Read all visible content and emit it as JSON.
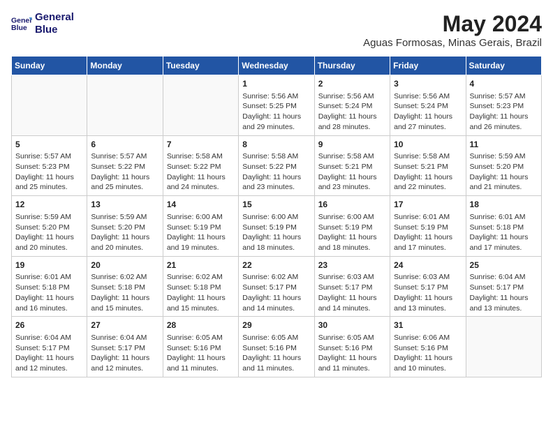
{
  "logo": {
    "line1": "General",
    "line2": "Blue"
  },
  "title": "May 2024",
  "location": "Aguas Formosas, Minas Gerais, Brazil",
  "weekdays": [
    "Sunday",
    "Monday",
    "Tuesday",
    "Wednesday",
    "Thursday",
    "Friday",
    "Saturday"
  ],
  "weeks": [
    [
      {
        "day": "",
        "info": ""
      },
      {
        "day": "",
        "info": ""
      },
      {
        "day": "",
        "info": ""
      },
      {
        "day": "1",
        "info": "Sunrise: 5:56 AM\nSunset: 5:25 PM\nDaylight: 11 hours\nand 29 minutes."
      },
      {
        "day": "2",
        "info": "Sunrise: 5:56 AM\nSunset: 5:24 PM\nDaylight: 11 hours\nand 28 minutes."
      },
      {
        "day": "3",
        "info": "Sunrise: 5:56 AM\nSunset: 5:24 PM\nDaylight: 11 hours\nand 27 minutes."
      },
      {
        "day": "4",
        "info": "Sunrise: 5:57 AM\nSunset: 5:23 PM\nDaylight: 11 hours\nand 26 minutes."
      }
    ],
    [
      {
        "day": "5",
        "info": "Sunrise: 5:57 AM\nSunset: 5:23 PM\nDaylight: 11 hours\nand 25 minutes."
      },
      {
        "day": "6",
        "info": "Sunrise: 5:57 AM\nSunset: 5:22 PM\nDaylight: 11 hours\nand 25 minutes."
      },
      {
        "day": "7",
        "info": "Sunrise: 5:58 AM\nSunset: 5:22 PM\nDaylight: 11 hours\nand 24 minutes."
      },
      {
        "day": "8",
        "info": "Sunrise: 5:58 AM\nSunset: 5:22 PM\nDaylight: 11 hours\nand 23 minutes."
      },
      {
        "day": "9",
        "info": "Sunrise: 5:58 AM\nSunset: 5:21 PM\nDaylight: 11 hours\nand 23 minutes."
      },
      {
        "day": "10",
        "info": "Sunrise: 5:58 AM\nSunset: 5:21 PM\nDaylight: 11 hours\nand 22 minutes."
      },
      {
        "day": "11",
        "info": "Sunrise: 5:59 AM\nSunset: 5:20 PM\nDaylight: 11 hours\nand 21 minutes."
      }
    ],
    [
      {
        "day": "12",
        "info": "Sunrise: 5:59 AM\nSunset: 5:20 PM\nDaylight: 11 hours\nand 20 minutes."
      },
      {
        "day": "13",
        "info": "Sunrise: 5:59 AM\nSunset: 5:20 PM\nDaylight: 11 hours\nand 20 minutes."
      },
      {
        "day": "14",
        "info": "Sunrise: 6:00 AM\nSunset: 5:19 PM\nDaylight: 11 hours\nand 19 minutes."
      },
      {
        "day": "15",
        "info": "Sunrise: 6:00 AM\nSunset: 5:19 PM\nDaylight: 11 hours\nand 18 minutes."
      },
      {
        "day": "16",
        "info": "Sunrise: 6:00 AM\nSunset: 5:19 PM\nDaylight: 11 hours\nand 18 minutes."
      },
      {
        "day": "17",
        "info": "Sunrise: 6:01 AM\nSunset: 5:19 PM\nDaylight: 11 hours\nand 17 minutes."
      },
      {
        "day": "18",
        "info": "Sunrise: 6:01 AM\nSunset: 5:18 PM\nDaylight: 11 hours\nand 17 minutes."
      }
    ],
    [
      {
        "day": "19",
        "info": "Sunrise: 6:01 AM\nSunset: 5:18 PM\nDaylight: 11 hours\nand 16 minutes."
      },
      {
        "day": "20",
        "info": "Sunrise: 6:02 AM\nSunset: 5:18 PM\nDaylight: 11 hours\nand 15 minutes."
      },
      {
        "day": "21",
        "info": "Sunrise: 6:02 AM\nSunset: 5:18 PM\nDaylight: 11 hours\nand 15 minutes."
      },
      {
        "day": "22",
        "info": "Sunrise: 6:02 AM\nSunset: 5:17 PM\nDaylight: 11 hours\nand 14 minutes."
      },
      {
        "day": "23",
        "info": "Sunrise: 6:03 AM\nSunset: 5:17 PM\nDaylight: 11 hours\nand 14 minutes."
      },
      {
        "day": "24",
        "info": "Sunrise: 6:03 AM\nSunset: 5:17 PM\nDaylight: 11 hours\nand 13 minutes."
      },
      {
        "day": "25",
        "info": "Sunrise: 6:04 AM\nSunset: 5:17 PM\nDaylight: 11 hours\nand 13 minutes."
      }
    ],
    [
      {
        "day": "26",
        "info": "Sunrise: 6:04 AM\nSunset: 5:17 PM\nDaylight: 11 hours\nand 12 minutes."
      },
      {
        "day": "27",
        "info": "Sunrise: 6:04 AM\nSunset: 5:17 PM\nDaylight: 11 hours\nand 12 minutes."
      },
      {
        "day": "28",
        "info": "Sunrise: 6:05 AM\nSunset: 5:16 PM\nDaylight: 11 hours\nand 11 minutes."
      },
      {
        "day": "29",
        "info": "Sunrise: 6:05 AM\nSunset: 5:16 PM\nDaylight: 11 hours\nand 11 minutes."
      },
      {
        "day": "30",
        "info": "Sunrise: 6:05 AM\nSunset: 5:16 PM\nDaylight: 11 hours\nand 11 minutes."
      },
      {
        "day": "31",
        "info": "Sunrise: 6:06 AM\nSunset: 5:16 PM\nDaylight: 11 hours\nand 10 minutes."
      },
      {
        "day": "",
        "info": ""
      }
    ]
  ]
}
